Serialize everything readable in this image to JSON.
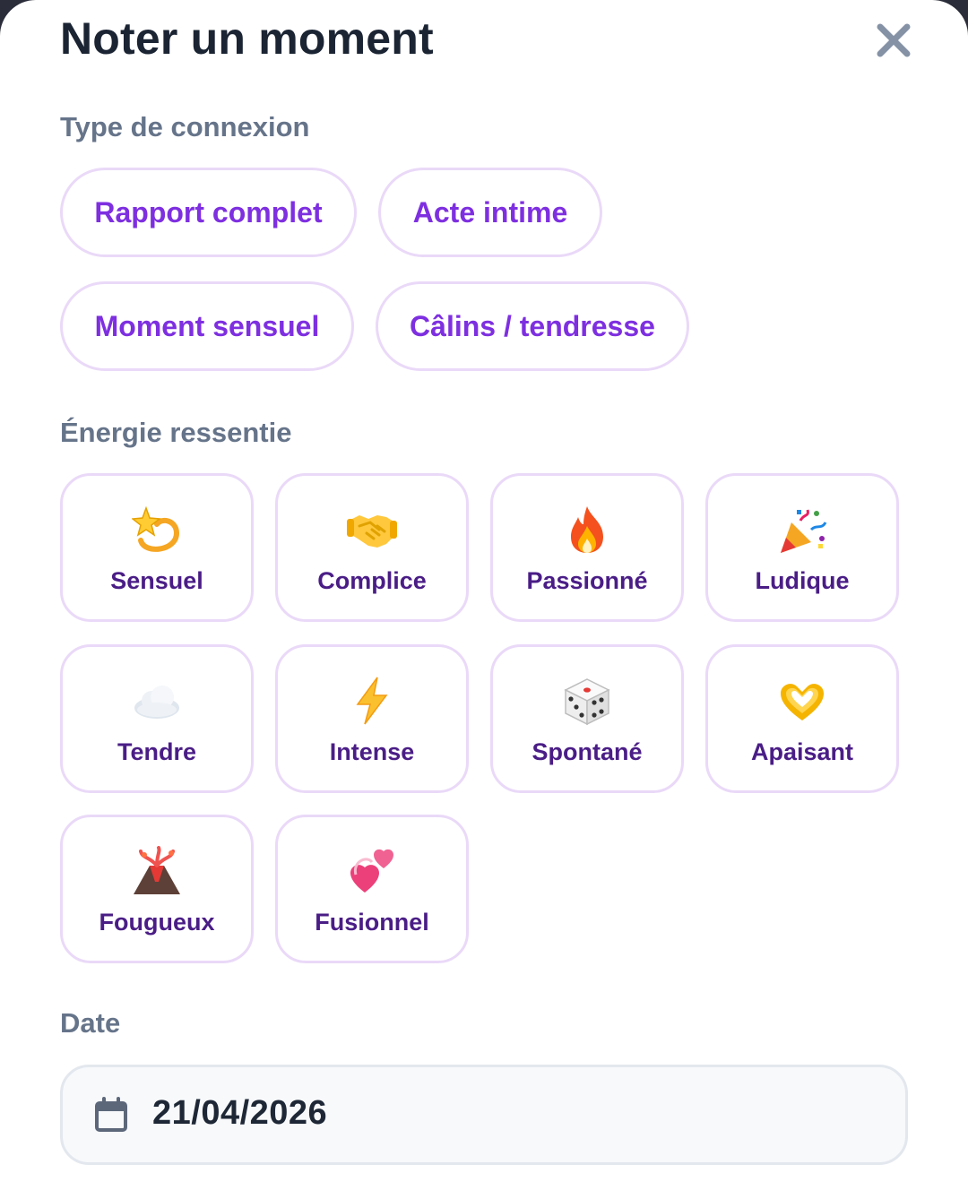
{
  "dialog": {
    "title": "Noter un moment",
    "close_icon": "close-icon"
  },
  "connection": {
    "label": "Type de connexion",
    "options": [
      {
        "label": "Rapport complet"
      },
      {
        "label": "Acte intime"
      },
      {
        "label": "Moment sensuel"
      },
      {
        "label": "Câlins / tendresse"
      }
    ]
  },
  "energy": {
    "label": "Énergie ressentie",
    "options": [
      {
        "label": "Sensuel",
        "icon": "dizzy-star-icon"
      },
      {
        "label": "Complice",
        "icon": "handshake-icon"
      },
      {
        "label": "Passionné",
        "icon": "fire-icon"
      },
      {
        "label": "Ludique",
        "icon": "party-popper-icon"
      },
      {
        "label": "Tendre",
        "icon": "cloud-icon"
      },
      {
        "label": "Intense",
        "icon": "lightning-icon"
      },
      {
        "label": "Spontané",
        "icon": "die-icon"
      },
      {
        "label": "Apaisant",
        "icon": "heart-hands-icon"
      },
      {
        "label": "Fougueux",
        "icon": "volcano-icon"
      },
      {
        "label": "Fusionnel",
        "icon": "two-hearts-icon"
      }
    ]
  },
  "date": {
    "label": "Date",
    "value": "21/04/2026",
    "icon": "calendar-icon"
  },
  "colors": {
    "accent": "#7e2fe0",
    "card_label": "#4a1d86",
    "border": "#ead9f8",
    "section_label": "#66748a",
    "title": "#1b2433"
  }
}
